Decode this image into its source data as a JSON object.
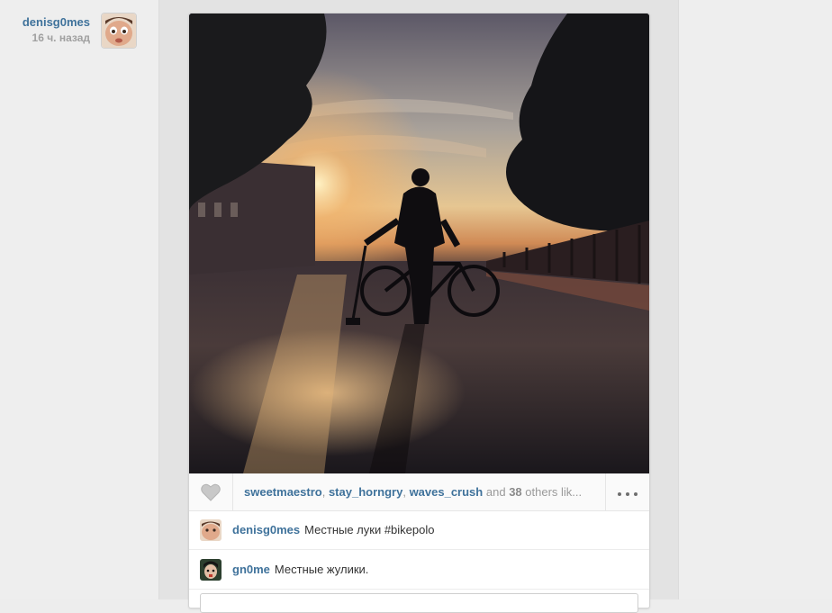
{
  "post": {
    "author": {
      "username": "denisg0mes",
      "time_ago": "16 ч. назад"
    },
    "likes": {
      "users": [
        "sweetmaestro",
        "stay_horngry",
        "waves_crush"
      ],
      "and_word": "and",
      "others_count": "38",
      "others_text": "others lik..."
    },
    "caption": {
      "username": "denisg0mes",
      "text": "Местные луки #bikepolo"
    },
    "comments": [
      {
        "username": "gn0me",
        "text": "Местные жулики."
      }
    ]
  },
  "colors": {
    "username": "#3f729b",
    "muted": "#9a9a9a",
    "background": "#ededed"
  },
  "icons": {
    "like": "heart-icon",
    "more": "ellipsis-icon"
  }
}
